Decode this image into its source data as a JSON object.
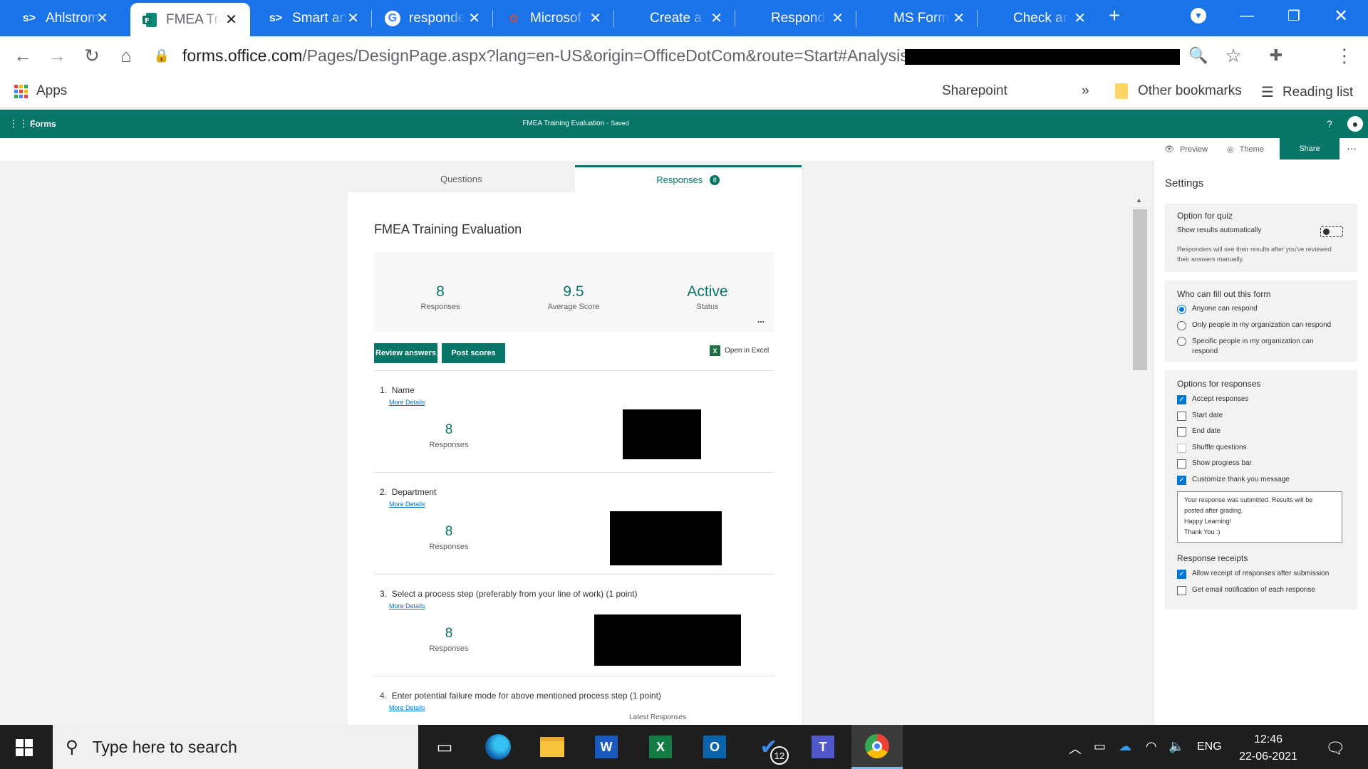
{
  "browser": {
    "tabs": [
      {
        "title": "Ahlstrom",
        "icon": "sharepoint-icon"
      },
      {
        "title": "FMEA Training Evaluation",
        "icon": "forms-icon",
        "active": true
      },
      {
        "title": "Smart an",
        "icon": "sharepoint-icon"
      },
      {
        "title": "responde",
        "icon": "google-icon"
      },
      {
        "title": "Microsof",
        "icon": "microsoft-answers-icon"
      },
      {
        "title": "Create a",
        "icon": "microsoft-icon"
      },
      {
        "title": "Respond",
        "icon": "microsoft-icon"
      },
      {
        "title": "MS Form",
        "icon": "microsoft-icon"
      },
      {
        "title": "Check an",
        "icon": "microsoft-icon"
      }
    ],
    "url_host": "forms.office.com",
    "url_path": "/Pages/DesignPage.aspx?lang=en-US&origin=OfficeDotCom&route=Start#Analysis=true&F",
    "bookmarks": {
      "apps": "Apps",
      "sharepoint": "Sharepoint",
      "more": "»",
      "other": "Other bookmarks",
      "reading_list": "Reading list"
    }
  },
  "appbar": {
    "app_name": "Forms",
    "doc_title": "FMEA Training Evaluation",
    "saved": "Saved",
    "help": "?"
  },
  "commands": {
    "preview": "Preview",
    "theme": "Theme",
    "share": "Share",
    "more": "···"
  },
  "form": {
    "tabs": {
      "questions": "Questions",
      "responses": "Responses",
      "responses_count": "8"
    },
    "title": "FMEA Training Evaluation",
    "summary": [
      {
        "value": "8",
        "label": "Responses"
      },
      {
        "value": "9.5",
        "label": "Average Score"
      },
      {
        "value": "Active",
        "label": "Status"
      }
    ],
    "summary_more": "...",
    "review_answers": "Review answers",
    "post_scores": "Post scores",
    "open_in_excel": "Open in Excel",
    "more_details": "More Details",
    "questions": [
      {
        "num": "1.",
        "text": "Name",
        "count": "8",
        "count_label": "Responses"
      },
      {
        "num": "2.",
        "text": "Department",
        "count": "8",
        "count_label": "Responses"
      },
      {
        "num": "3.",
        "text": "Select a process step (preferably from your line of work) (1 point)",
        "count": "8",
        "count_label": "Responses"
      },
      {
        "num": "4.",
        "text": "Enter potential failure mode for above mentioned process step (1 point)",
        "latest": "Latest Responses"
      }
    ]
  },
  "settings": {
    "title": "Settings",
    "quiz": {
      "heading": "Option for quiz",
      "show_results": "Show results automatically",
      "note": "Responders will see their results after you've reviewed their answers manually."
    },
    "who": {
      "heading": "Who can fill out this form",
      "options": [
        "Anyone can respond",
        "Only people in my organization can respond",
        "Specific people in my organization can respond"
      ],
      "selected": 0
    },
    "responses": {
      "heading": "Options for responses",
      "options": [
        {
          "label": "Accept responses",
          "checked": true
        },
        {
          "label": "Start date",
          "checked": false
        },
        {
          "label": "End date",
          "checked": false
        },
        {
          "label": "Shuffle questions",
          "checked": false,
          "disabled": true
        },
        {
          "label": "Show progress bar",
          "checked": false
        },
        {
          "label": "Customize thank you message",
          "checked": true
        }
      ],
      "thank_you_lines": [
        "Your response was submitted. Results will be",
        "posted after grading.",
        "Happy Learning!",
        "Thank You :)"
      ]
    },
    "receipts": {
      "heading": "Response receipts",
      "options": [
        {
          "label": "Allow receipt of responses after submission",
          "checked": true
        },
        {
          "label": "Get email notification of each response",
          "checked": false
        }
      ]
    }
  },
  "taskbar": {
    "search_placeholder": "Type here to search",
    "todo_badge": "12",
    "language": "ENG",
    "time": "12:46",
    "date": "22-06-2021"
  },
  "colors": {
    "forms_teal": "#077568",
    "chrome_blue": "#1a73e8",
    "link_blue": "#0078d4"
  }
}
